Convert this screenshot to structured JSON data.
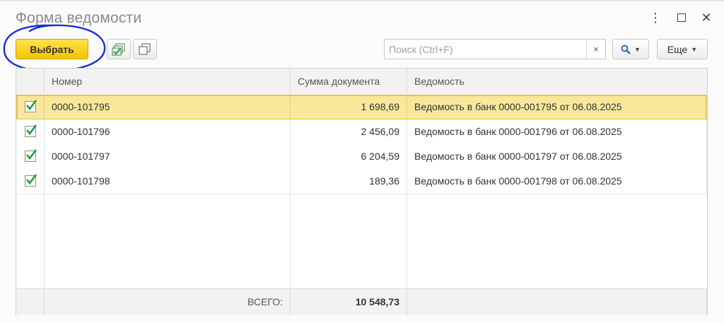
{
  "window": {
    "title": "Форма ведомости",
    "more_icon": "kebab-icon",
    "maximize_icon": "maximize-icon",
    "close_icon": "close-icon"
  },
  "toolbar": {
    "select_label": "Выбрать",
    "check_all_icon": "check-all-icon",
    "copy_icon": "copy-icon",
    "search_placeholder": "Поиск (Ctrl+F)",
    "search_value": "",
    "clear_label": "×",
    "find_icon": "magnifier-icon",
    "more_label": "Еще"
  },
  "table": {
    "columns": [
      "",
      "Номер",
      "Сумма документа",
      "Ведомость"
    ],
    "rows": [
      {
        "checked": true,
        "number": "0000-101795",
        "amount": "1 698,69",
        "statement": "Ведомость в банк 0000-001795 от 06.08.2025",
        "selected": true
      },
      {
        "checked": true,
        "number": "0000-101796",
        "amount": "2 456,09",
        "statement": "Ведомость в банк 0000-001796 от 06.08.2025",
        "selected": false
      },
      {
        "checked": true,
        "number": "0000-101797",
        "amount": "6 204,59",
        "statement": "Ведомость в банк 0000-001797 от 06.08.2025",
        "selected": false
      },
      {
        "checked": true,
        "number": "0000-101798",
        "amount": "189,36",
        "statement": "Ведомость в банк 0000-001798 от 06.08.2025",
        "selected": false
      }
    ],
    "footer": {
      "total_label": "ВСЕГО:",
      "total_value": "10 548,73"
    }
  },
  "colors": {
    "accent_yellow": "#f1c400",
    "selected_row": "#f9e79a",
    "checkmark": "#1f9e3e",
    "annotation_circle": "#1a2fd6"
  }
}
